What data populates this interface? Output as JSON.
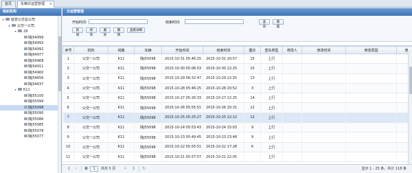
{
  "tabs": {
    "home": "首页",
    "active": "车辆日运营管理",
    "close": "×"
  },
  "left_panel": {
    "title": "组织机构",
    "tree": [
      {
        "label": "延安公交总公司",
        "level": 0,
        "toggle": "▾",
        "folder": true
      },
      {
        "label": "公交一公司",
        "level": 1,
        "toggle": "▾",
        "folder": true
      },
      {
        "label": "29",
        "level": 2,
        "toggle": "▾",
        "folder": true
      },
      {
        "label": "陕J54999",
        "level": 3,
        "toggle": "",
        "folder": false
      },
      {
        "label": "陕J54993",
        "level": 3,
        "toggle": "",
        "folder": false
      },
      {
        "label": "陕J54992",
        "level": 3,
        "toggle": "",
        "folder": false
      },
      {
        "label": "陕J64977",
        "level": 3,
        "toggle": "",
        "folder": false
      },
      {
        "label": "陕J54968",
        "level": 3,
        "toggle": "",
        "folder": false
      },
      {
        "label": "陕J54911",
        "level": 3,
        "toggle": "",
        "folder": false
      },
      {
        "label": "陕J54960",
        "level": 3,
        "toggle": "",
        "folder": false
      },
      {
        "label": "陕J54656",
        "level": 3,
        "toggle": "",
        "folder": false
      },
      {
        "label": "陕J54637",
        "level": 3,
        "toggle": "",
        "folder": false
      },
      {
        "label": "K11",
        "level": 2,
        "toggle": "▾",
        "folder": true
      },
      {
        "label": "陕J55100",
        "level": 3,
        "toggle": "",
        "folder": false
      },
      {
        "label": "陕J55099",
        "level": 3,
        "toggle": "",
        "folder": false
      },
      {
        "label": "陕J55098",
        "level": 3,
        "toggle": "",
        "folder": false,
        "selected": true
      },
      {
        "label": "陕J55090",
        "level": 3,
        "toggle": "",
        "folder": false
      },
      {
        "label": "陕J55086",
        "level": 3,
        "toggle": "",
        "folder": false
      },
      {
        "label": "陕J55085",
        "level": 3,
        "toggle": "",
        "folder": false
      },
      {
        "label": "陕J55078",
        "level": 3,
        "toggle": "",
        "folder": false
      },
      {
        "label": "陕J55077",
        "level": 3,
        "toggle": "",
        "folder": false
      }
    ]
  },
  "main_panel": {
    "title": "日运营管理",
    "form": {
      "start_label": "开始时间:",
      "end_label": "结束时间:",
      "query_btn": "查询",
      "reset_btn": "重置",
      "toolbar": [
        "新增",
        "修改",
        "删除",
        "撤销",
        "查看详细"
      ]
    },
    "grid": {
      "columns": [
        "序号",
        "机构",
        "线路",
        "车辆",
        "开始时间",
        "结束时间",
        "圈次",
        "营车类型",
        "修改人",
        "修改时间",
        "修改原因",
        "修"
      ],
      "rows": [
        [
          "1",
          "公交一公司",
          "K11",
          "陕J55098",
          "2015-10-31 05:46:25",
          "2015-10-31 20:57",
          "15",
          "上行",
          "",
          "",
          "",
          ""
        ],
        [
          "2",
          "公交一公司",
          "K11",
          "陕J55098",
          "2015-10-30 05:06:53",
          "2015-10-30 22:25",
          "15",
          "上行",
          "",
          "",
          "",
          ""
        ],
        [
          "3",
          "公交一公司",
          "K11",
          "陕J55098",
          "2015-10-29 06:32:47",
          "2015-10-29 22:25",
          "13",
          "上行",
          "",
          "",
          "",
          ""
        ],
        [
          "4",
          "公交一公司",
          "K11",
          "陕J55098",
          "2015-10-28 05:46:25",
          "2015-10-28 20:52",
          "3",
          "上行",
          "",
          "",
          "",
          ""
        ],
        [
          "5",
          "公交一公司",
          "K11",
          "陕J55098",
          "2015-10-27 05:26:33",
          "2015-10-27 22:25",
          "14",
          "上行",
          "",
          "",
          "",
          ""
        ],
        [
          "6",
          "公交一公司",
          "K11",
          "陕J55098",
          "2015-10-26 05:55:51",
          "2015-10-26 20:31",
          "12",
          "上行",
          "",
          "",
          "",
          ""
        ],
        [
          "7",
          "公交一公司",
          "K11",
          "陕J55098",
          "2015-10-25 05:25:27",
          "2015-10-25 22:12",
          "12",
          "上行",
          "",
          "",
          "",
          ""
        ],
        [
          "8",
          "公交一公司",
          "K11",
          "陕J55098",
          "2015-10-24 05:53:43",
          "2015-10-24 15:03",
          "9",
          "上行",
          "",
          "",
          "",
          ""
        ],
        [
          "9",
          "公交一公司",
          "K11",
          "陕J55098",
          "2015-10-23 05:49:45",
          "2015-10-23 23:48",
          "9",
          "上行",
          "",
          "",
          "",
          ""
        ],
        [
          "10",
          "公交一公司",
          "K11",
          "陕J55098",
          "2015-10-22 05:55:51",
          "2015-10-22 17:28",
          "6",
          "上行",
          "",
          "",
          "",
          ""
        ],
        [
          "11",
          "公交一公司",
          "K11",
          "陕J55098",
          "2015-10-21 05:57:57",
          "2015-10-21 22:05",
          "",
          "上行",
          "",
          "",
          "",
          ""
        ]
      ]
    },
    "pager": {
      "first": "⟪",
      "prev": "‹",
      "page_label": "第",
      "page_value": "1",
      "total_pages": "共共 5 页",
      "next": "»",
      "last": "⟫",
      "refresh": "↻",
      "summary": "显示 1 - 25 条，共计 118 条"
    }
  }
}
